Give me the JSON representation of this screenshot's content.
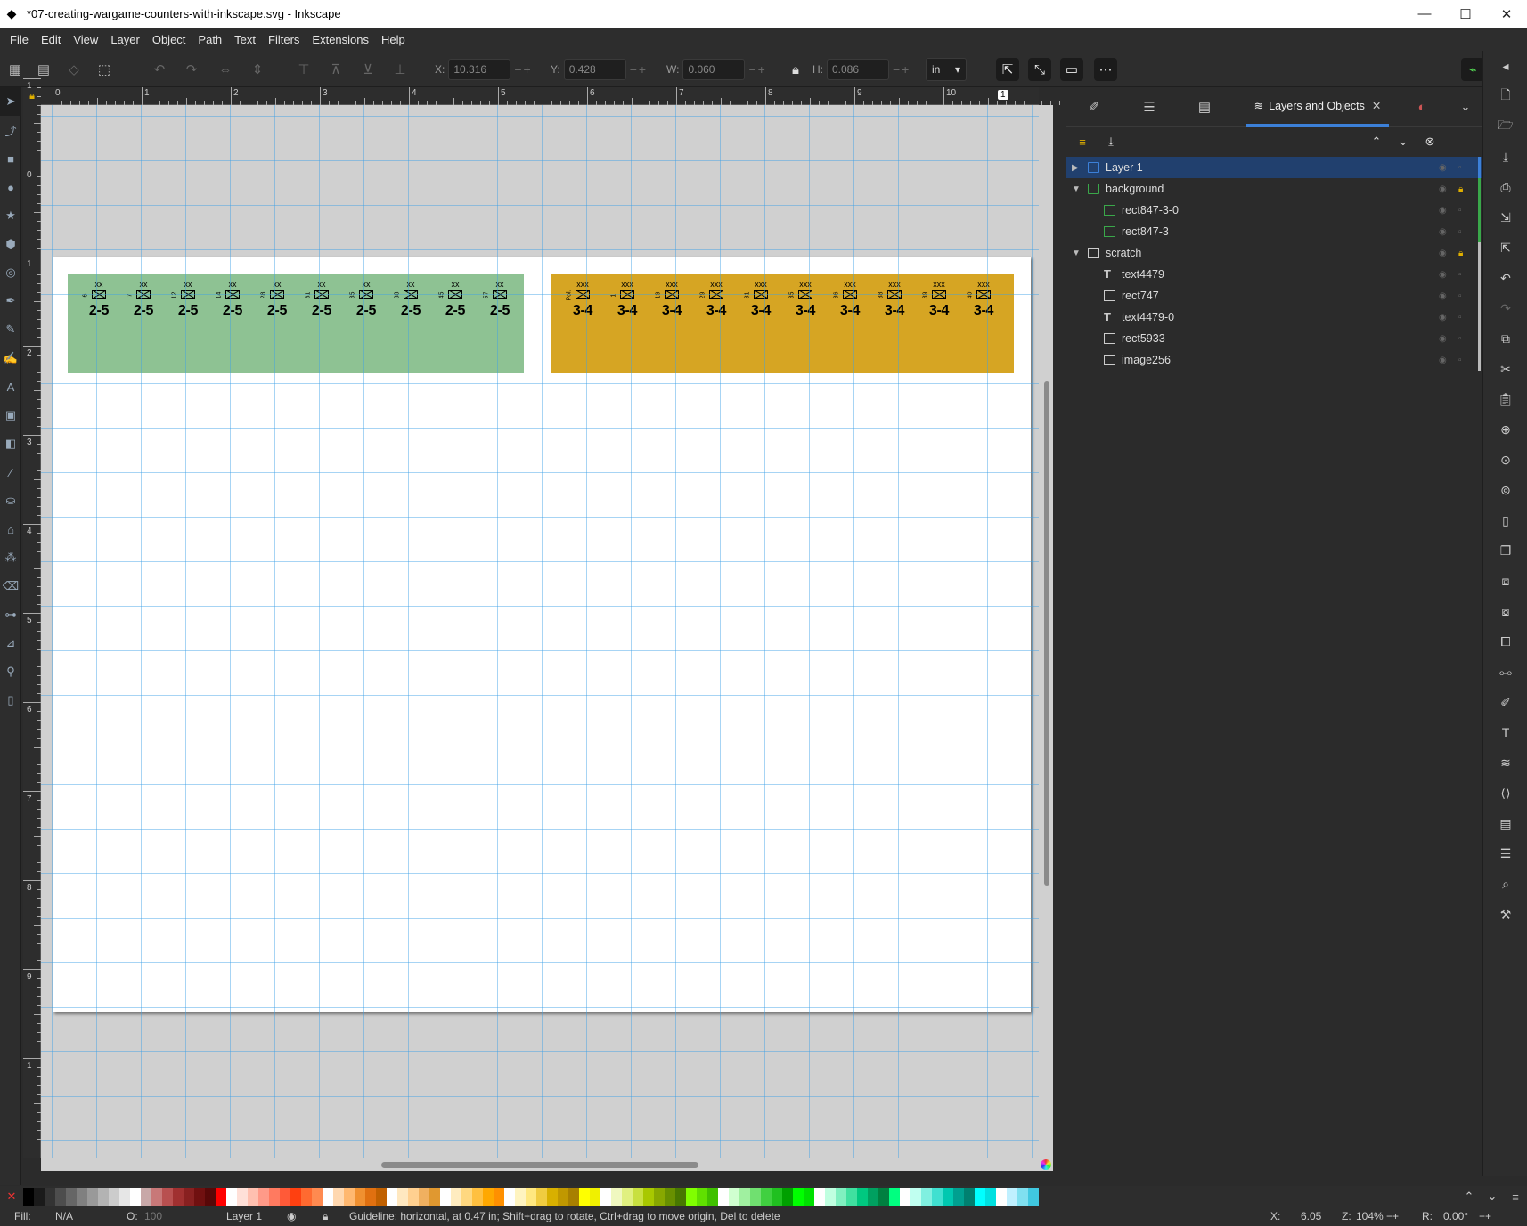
{
  "window": {
    "title": "*07-creating-wargame-counters-with-inkscape.svg - Inkscape",
    "minimize": "—",
    "maximize": "☐",
    "close": "✕"
  },
  "menu": [
    "File",
    "Edit",
    "View",
    "Layer",
    "Object",
    "Path",
    "Text",
    "Filters",
    "Extensions",
    "Help"
  ],
  "toolbar": {
    "x": {
      "label": "X:",
      "value": "10.316"
    },
    "y": {
      "label": "Y:",
      "value": "0.428"
    },
    "w": {
      "label": "W:",
      "value": "0.060"
    },
    "h": {
      "label": "H:",
      "value": "0.086"
    },
    "units": "in"
  },
  "rulers": {
    "h_labels": [
      "0",
      "1",
      "2",
      "3",
      "4",
      "5",
      "6",
      "7",
      "8",
      "9",
      "10"
    ],
    "v_labels": [
      "1",
      "0",
      "1",
      "2",
      "3",
      "4",
      "5",
      "6",
      "7",
      "8",
      "9",
      "1"
    ],
    "corner_badge": "1"
  },
  "counters": {
    "green": [
      {
        "ech": "xx",
        "unit": "6",
        "value": "2-5"
      },
      {
        "ech": "xx",
        "unit": "7",
        "value": "2-5"
      },
      {
        "ech": "xx",
        "unit": "12",
        "value": "2-5"
      },
      {
        "ech": "xx",
        "unit": "14",
        "value": "2-5"
      },
      {
        "ech": "xx",
        "unit": "28",
        "value": "2-5"
      },
      {
        "ech": "xx",
        "unit": "31",
        "value": "2-5"
      },
      {
        "ech": "xx",
        "unit": "35",
        "value": "2-5"
      },
      {
        "ech": "xx",
        "unit": "38",
        "value": "2-5"
      },
      {
        "ech": "xx",
        "unit": "45",
        "value": "2-5"
      },
      {
        "ech": "xx",
        "unit": "57",
        "value": "2-5"
      }
    ],
    "gold": [
      {
        "ech": "xxx",
        "unit": "Pol.",
        "value": "3-4"
      },
      {
        "ech": "xxx",
        "unit": "1",
        "value": "3-4"
      },
      {
        "ech": "xxx",
        "unit": "19",
        "value": "3-4"
      },
      {
        "ech": "xxx",
        "unit": "29",
        "value": "3-4"
      },
      {
        "ech": "xxx",
        "unit": "31",
        "value": "3-4"
      },
      {
        "ech": "xxx",
        "unit": "35",
        "value": "3-4"
      },
      {
        "ech": "xxx",
        "unit": "36",
        "value": "3-4"
      },
      {
        "ech": "xxx",
        "unit": "38",
        "value": "3-4"
      },
      {
        "ech": "xxx",
        "unit": "39",
        "value": "3-4"
      },
      {
        "ech": "xxx",
        "unit": "40",
        "value": "3-4"
      }
    ],
    "colors": {
      "green": "#8ec293",
      "gold": "#d6a523"
    }
  },
  "dialog": {
    "tab_label": "Layers and Objects",
    "tab_close": "✕",
    "tree": [
      {
        "label": "Layer 1",
        "type": "layer",
        "depth": 0,
        "expander": "▶",
        "selected": true,
        "locked": false,
        "bar": "#3c80d8"
      },
      {
        "label": "background",
        "type": "layer",
        "depth": 0,
        "expander": "▼",
        "selected": false,
        "locked": true,
        "bar": "#3aa84a"
      },
      {
        "label": "rect847-3-0",
        "type": "rect-green",
        "depth": 1,
        "expander": "",
        "selected": false,
        "locked": false,
        "bar": "#3aa84a"
      },
      {
        "label": "rect847-3",
        "type": "rect-green",
        "depth": 1,
        "expander": "",
        "selected": false,
        "locked": false,
        "bar": "#3aa84a"
      },
      {
        "label": "scratch",
        "type": "layer-white",
        "depth": 0,
        "expander": "▼",
        "selected": false,
        "locked": true,
        "bar": "#bbbbbb"
      },
      {
        "label": "text4479",
        "type": "text",
        "depth": 1,
        "expander": "",
        "selected": false,
        "locked": false,
        "bar": "#bbbbbb"
      },
      {
        "label": "rect747",
        "type": "rect-white",
        "depth": 1,
        "expander": "",
        "selected": false,
        "locked": false,
        "bar": "#bbbbbb"
      },
      {
        "label": "text4479-0",
        "type": "text",
        "depth": 1,
        "expander": "",
        "selected": false,
        "locked": false,
        "bar": "#bbbbbb"
      },
      {
        "label": "rect5933",
        "type": "rect-white",
        "depth": 1,
        "expander": "",
        "selected": false,
        "locked": false,
        "bar": "#bbbbbb"
      },
      {
        "label": "image256",
        "type": "image",
        "depth": 1,
        "expander": "",
        "selected": false,
        "locked": false,
        "bar": "#bbbbbb"
      }
    ]
  },
  "palette": [
    "#000000",
    "#1a1a1a",
    "#333333",
    "#4d4d4d",
    "#666666",
    "#808080",
    "#999999",
    "#b3b3b3",
    "#cccccc",
    "#e6e6e6",
    "#ffffff",
    "#c8a8a8",
    "#c87878",
    "#b85050",
    "#a03030",
    "#882020",
    "#701010",
    "#580808",
    "#ff0000",
    "#ffffff",
    "#ffe0d8",
    "#ffc0b0",
    "#ff9a88",
    "#ff7a60",
    "#ff5a38",
    "#ff4010",
    "#ff6a30",
    "#ff8a50",
    "#ffffff",
    "#ffd8b0",
    "#ffb870",
    "#f09030",
    "#e07010",
    "#c06000",
    "#ffffff",
    "#ffe8c0",
    "#ffd090",
    "#f0b060",
    "#e09830",
    "#ffffff",
    "#ffecc0",
    "#ffd880",
    "#ffc040",
    "#ffa800",
    "#ff9000",
    "#ffffff",
    "#fff4c0",
    "#ffe880",
    "#f0cc40",
    "#d8b000",
    "#c09800",
    "#a88000",
    "#ffff00",
    "#f0f000",
    "#ffffff",
    "#f0f8c0",
    "#e0f080",
    "#c8e040",
    "#a8c800",
    "#88a800",
    "#689000",
    "#487800",
    "#80ff00",
    "#60e000",
    "#40c000",
    "#ffffff",
    "#d0ffd0",
    "#a0f0a0",
    "#70e070",
    "#40d040",
    "#20c020",
    "#00a000",
    "#00ff00",
    "#00e000",
    "#ffffff",
    "#c0ffe0",
    "#80f0c0",
    "#40e0a0",
    "#00c880",
    "#00a060",
    "#008040",
    "#00ff80",
    "#ffffff",
    "#c0fff0",
    "#80f0e0",
    "#40e0d0",
    "#00c8b0",
    "#00a090",
    "#008070",
    "#00ffff",
    "#00e0e0",
    "#ffffff",
    "#c0f0ff",
    "#80e0f0",
    "#40c8e0"
  ],
  "status": {
    "fill_label": "Fill:",
    "fill_value": "N/A",
    "opacity_label": "O:",
    "opacity_value": "100",
    "layer": "Layer 1",
    "message": "Guideline: horizontal, at 0.47 in; Shift+drag to rotate, Ctrl+drag to move origin, Del to delete",
    "x_label": "X:",
    "x_value": "6.05",
    "zoom_label": "Z:",
    "zoom_value": "104%",
    "rotation_label": "R:",
    "rotation_value": "0.00°"
  }
}
